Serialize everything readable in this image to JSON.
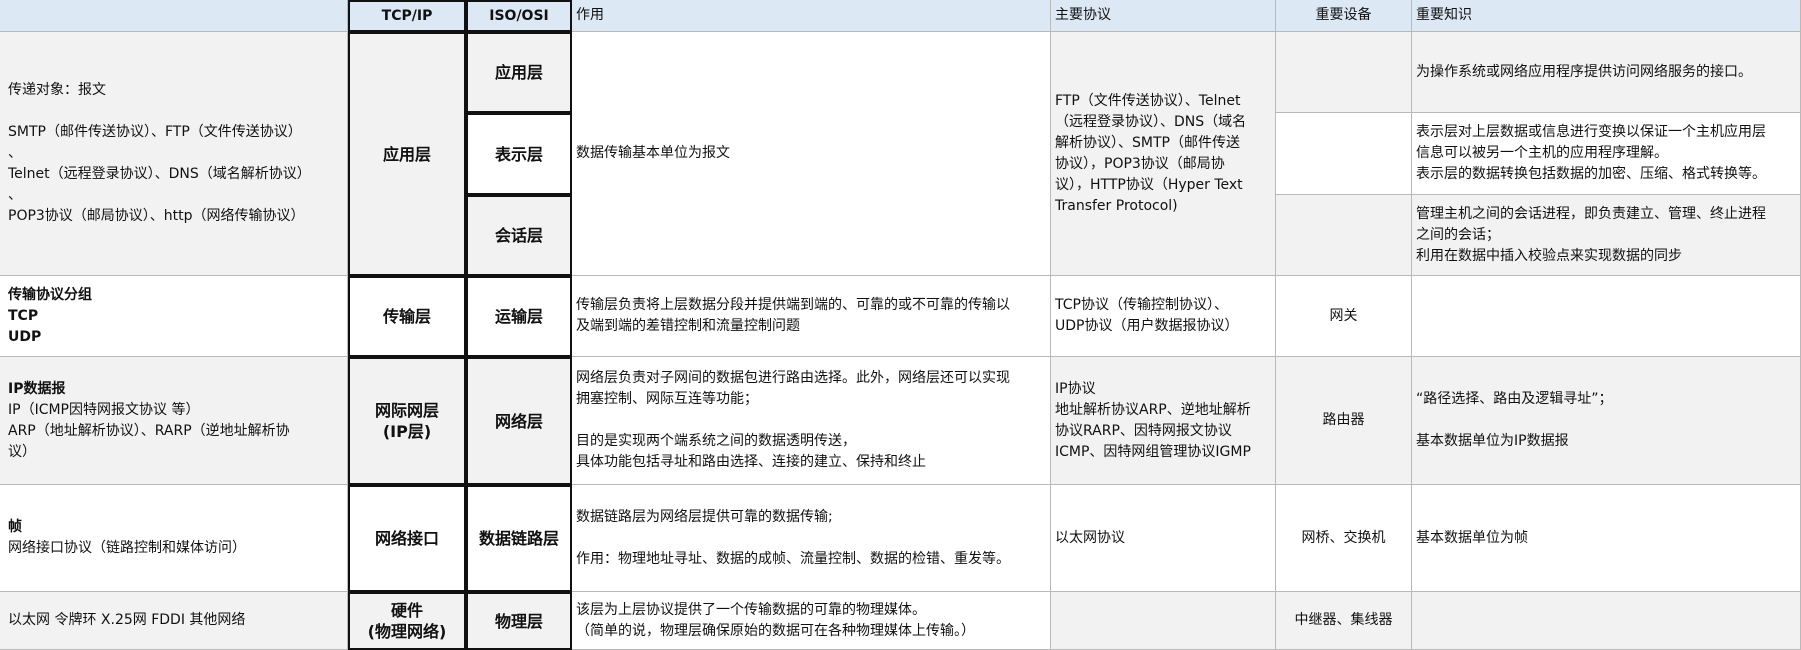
{
  "header": {
    "tcpip": "TCP/IP",
    "isoosi": "ISO/OSI",
    "role": "作用",
    "protocols": "主要协议",
    "devices": "重要设备",
    "knowledge": "重要知识"
  },
  "application": {
    "object": "传递对象：报文\n\nSMTP（邮件传送协议）、FTP（文件传送协议）\n、\nTelnet（远程登录协议）、DNS（域名解析协议）\n、\nPOP3协议（邮局协议）、http（网络传输协议）",
    "tcpip_layer": "应用层",
    "osi_app": "应用层",
    "osi_presentation": "表示层",
    "osi_session": "会话层",
    "role": "数据传输基本单位为报文",
    "protocols": "FTP（文件传送协议）、Telnet\n（远程登录协议）、DNS（域名\n解析协议）、SMTP（邮件传送\n协议），POP3协议（邮局协\n议），HTTP协议（Hyper Text\nTransfer Protocol)",
    "knowledge_app": "为操作系统或网络应用程序提供访问网络服务的接口。",
    "knowledge_presentation": "表示层对上层数据或信息进行变换以保证一个主机应用层\n信息可以被另一个主机的应用程序理解。\n表示层的数据转换包括数据的加密、压缩、格式转换等。",
    "knowledge_session": "管理主机之间的会话进程，即负责建立、管理、终止进程\n之间的会话；\n利用在数据中插入校验点来实现数据的同步"
  },
  "transport": {
    "object": "传输协议分组\nTCP\nUDP",
    "tcpip_layer": "传输层",
    "osi_layer": "运输层",
    "role": "传输层负责将上层数据分段并提供端到端的、可靠的或不可靠的传输以\n及端到端的差错控制和流量控制问题",
    "protocols": "TCP协议（传输控制协议）、\nUDP协议（用户数据报协议）",
    "device": "网关",
    "knowledge": ""
  },
  "network": {
    "object_title": "IP数据报",
    "object_body": "IP（ICMP因特网报文协议 等）\nARP（地址解析协议）、RARP（逆地址解析协\n议）",
    "tcpip_layer": "网际网层\n(IP层)",
    "osi_layer": "网络层",
    "role": "网络层负责对子网间的数据包进行路由选择。此外，网络层还可以实现\n拥塞控制、网际互连等功能；\n\n目的是实现两个端系统之间的数据透明传送，\n具体功能包括寻址和路由选择、连接的建立、保持和终止",
    "protocols": "IP协议\n地址解析协议ARP、逆地址解析\n协议RARP、因特网报文协议\nICMP、因特网组管理协议IGMP",
    "device": "路由器",
    "knowledge": " “路径选择、路由及逻辑寻址”；\n\n基本数据单位为IP数据报"
  },
  "datalink": {
    "object_title": "帧",
    "object_body": "网络接口协议（链路控制和媒体访问）",
    "tcpip_layer": "网络接口",
    "osi_layer": "数据链路层",
    "role": "数据链路层为网络层提供可靠的数据传输;\n\n作用：物理地址寻址、数据的成帧、流量控制、数据的检错、重发等。",
    "protocols": "以太网协议",
    "device": "网桥、交换机",
    "knowledge": "基本数据单位为帧"
  },
  "physical": {
    "object": "以太网  令牌环  X.25网  FDDI  其他网络",
    "tcpip_layer": "硬件\n(物理网络)",
    "osi_layer": "物理层",
    "role": "该层为上层协议提供了一个传输数据的可靠的物理媒体。\n（简单的说，物理层确保原始的数据可在各种物理媒体上传输。）",
    "protocols": "",
    "device": "中继器、集线器",
    "knowledge": ""
  }
}
